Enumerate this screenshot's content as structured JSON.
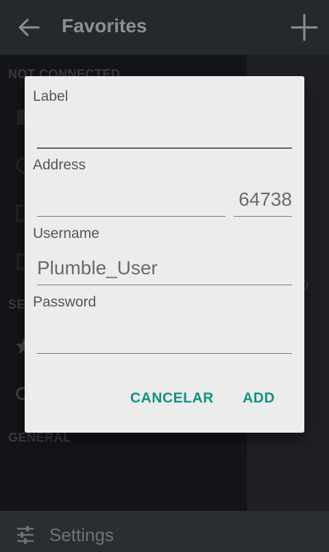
{
  "appbar": {
    "title": "Favorites"
  },
  "drawer": {
    "section_not_connected": "NOT CONNECTED",
    "section_servers": "SE",
    "section_general": "GENERAL",
    "settings_label": "Settings"
  },
  "background_fragment": "o",
  "dialog": {
    "label_caption": "Label",
    "label_value": "",
    "address_caption": "Address",
    "address_value": "",
    "port_value": "64738",
    "username_caption": "Username",
    "username_value": "Plumble_User",
    "password_caption": "Password",
    "password_value": "",
    "cancel_label": "CANCELAR",
    "add_label": "ADD"
  },
  "colors": {
    "accent": "#0f9383",
    "appbar": "#3a3f47",
    "drawer": "#1e2126",
    "dialog": "#ececec"
  }
}
